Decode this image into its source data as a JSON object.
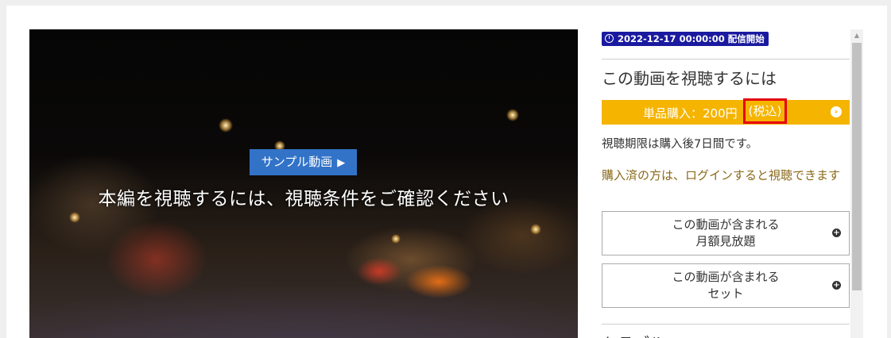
{
  "video": {
    "sample_button": "サンプル動画",
    "sample_arrow": "▶",
    "overlay_text": "本編を視聴するには、視聴条件をご確認ください"
  },
  "panel": {
    "release_badge": "2022-12-17 00:00:00 配信開始",
    "heading": "この動画を視聴するには",
    "purchase": {
      "label": "単品購入：200円",
      "tax_note": "(税込)"
    },
    "period_note": "視聴期限は購入後7日間です。",
    "login_note": "購入済の方は、ログインすると視聴できます",
    "options": [
      {
        "line1": "この動画が含まれる",
        "line2": "月額見放題"
      },
      {
        "line1": "この動画が含まれる",
        "line2": "セット"
      }
    ],
    "next_heading_partial": "トラブル"
  },
  "colors": {
    "accent_blue": "#3273c8",
    "badge_navy": "#1a1aa0",
    "purchase_yellow": "#f5b400",
    "highlight_red": "#e60012",
    "login_text": "#8a6a1a"
  },
  "icons": {
    "badge": "clock-icon",
    "purchase": "chevron-right-circle-icon",
    "option": "plus-circle-icon"
  }
}
